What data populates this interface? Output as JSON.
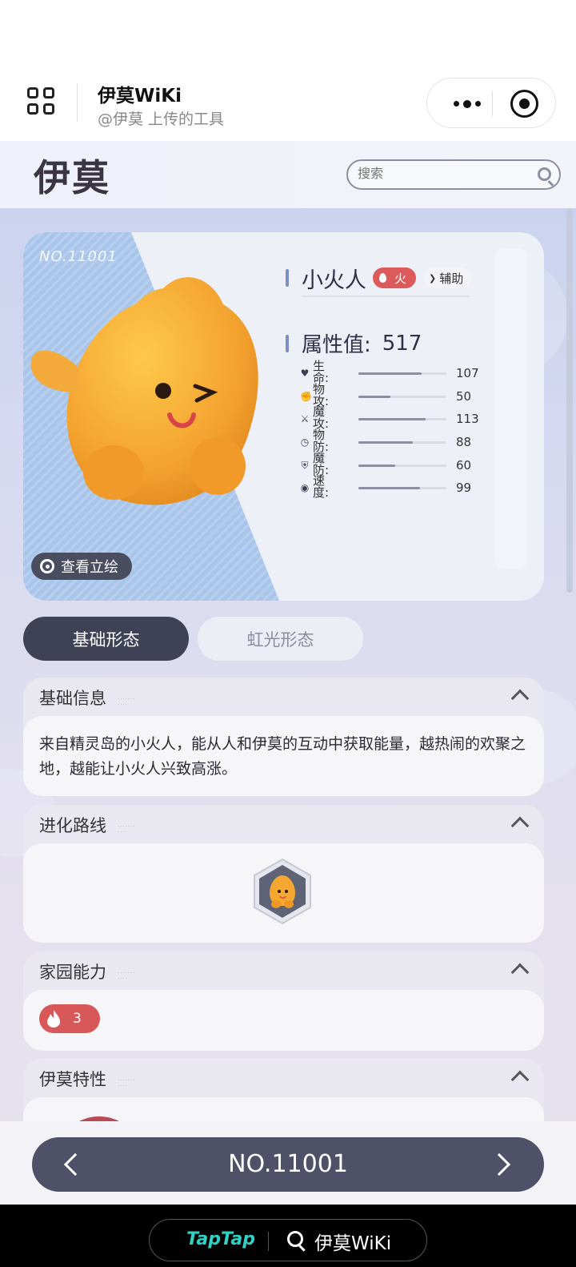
{
  "miniprogram": {
    "title": "伊莫WiKi",
    "subtitle": "@伊莫 上传的工具"
  },
  "site": {
    "logo_text": "伊莫",
    "search_placeholder": "搜索"
  },
  "hero": {
    "number": "NO.11001",
    "name": "小火人",
    "element": "火",
    "element_color": "#dd5a5a",
    "role": "辅助",
    "total_label": "属性值:",
    "total_value": "517",
    "view_art_label": "查看立绘",
    "stats": [
      {
        "label": "生命:",
        "icon": "heart-icon",
        "value": 107,
        "fill": 0.72
      },
      {
        "label": "物攻:",
        "icon": "fist-icon",
        "value": 50,
        "fill": 0.36
      },
      {
        "label": "魔攻:",
        "icon": "sword-icon",
        "value": 113,
        "fill": 0.76
      },
      {
        "label": "物防:",
        "icon": "clock-icon",
        "value": 88,
        "fill": 0.62
      },
      {
        "label": "魔防:",
        "icon": "shield-icon",
        "value": 60,
        "fill": 0.42
      },
      {
        "label": "速度:",
        "icon": "target-icon",
        "value": 99,
        "fill": 0.7
      }
    ]
  },
  "tabs": [
    {
      "label": "基础形态",
      "active": true
    },
    {
      "label": "虹光形态",
      "active": false
    }
  ],
  "sections": {
    "basic": {
      "title": "基础信息",
      "text": "来自精灵岛的小火人，能从人和伊莫的互动中获取能量，越热闹的欢聚之地，越能让小火人兴致高涨。"
    },
    "evolution": {
      "title": "进化路线"
    },
    "home": {
      "title": "家园能力",
      "level": "3"
    },
    "trait": {
      "title": "伊莫特性"
    }
  },
  "nav": {
    "number": "NO.11001"
  },
  "taptap": {
    "brand": "TapTap",
    "label": "伊莫WiKi"
  }
}
